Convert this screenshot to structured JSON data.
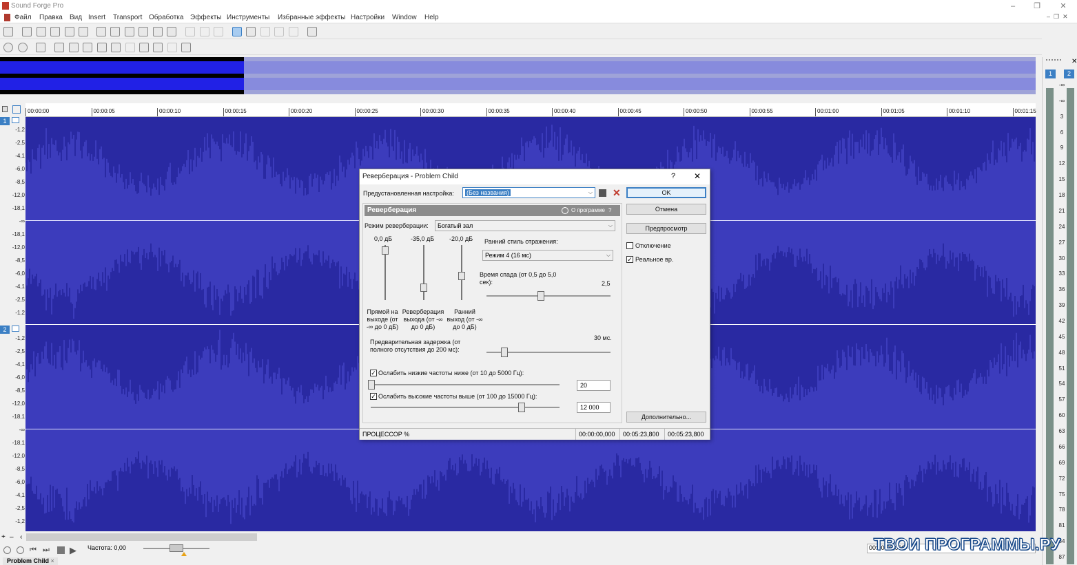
{
  "window": {
    "title": "Sound Forge Pro",
    "controls": [
      "minimize-icon",
      "restore-icon",
      "close-icon"
    ]
  },
  "menu": [
    "Файл",
    "Правка",
    "Вид",
    "Insert",
    "Transport",
    "Обработка",
    "Эффекты",
    "Инструменты",
    "Избранные эффекты",
    "Настройки",
    "Window",
    "Help"
  ],
  "ruler": {
    "ticks": [
      "00:00:00",
      "00:00:05",
      "00:00:10",
      "00:00:15",
      "00:00:20",
      "00:00:25",
      "00:00:30",
      "00:00:35",
      "00:00:40",
      "00:00:45",
      "00:00:50",
      "00:00:55",
      "00:01:00",
      "00:01:05",
      "00:01:10",
      "00:01:15"
    ]
  },
  "channels": [
    {
      "badge": "1",
      "db_labels": [
        "-1,2",
        "-2,5",
        "-4,1",
        "-6,0",
        "-8,5",
        "-12,0",
        "-18,1",
        "-∞",
        "-18,1",
        "-12,0",
        "-8,5",
        "-6,0",
        "-4,1",
        "-2,5",
        "-1,2"
      ]
    },
    {
      "badge": "2",
      "db_labels": [
        "-1,2",
        "-2,5",
        "-4,1",
        "-6,0",
        "-8,5",
        "-12,0",
        "-18,1",
        "-∞",
        "-18,1",
        "-12,0",
        "-8,5",
        "-6,0",
        "-4,1",
        "-2,5",
        "-1,2"
      ]
    }
  ],
  "vu": {
    "buttons": [
      "1",
      "2"
    ],
    "labels": [
      "-∞",
      "-∞",
      "3",
      "6",
      "9",
      "12",
      "15",
      "18",
      "21",
      "24",
      "27",
      "30",
      "33",
      "36",
      "39",
      "42",
      "45",
      "48",
      "51",
      "54",
      "57",
      "60",
      "63",
      "66",
      "69",
      "72",
      "75",
      "78",
      "81",
      "84",
      "87"
    ]
  },
  "bottom": {
    "rate_label": "Частота: 0,00",
    "tab_label": "Problem Child",
    "tab_close": "×",
    "status_time": "00:00:00,000"
  },
  "watermark": "ТВОИ ПРОГРАММЫ.РУ",
  "dialog": {
    "title": "Реверберация - Problem Child",
    "help": "?",
    "close": "✕",
    "preset_label": "Предустановленная настройка:",
    "preset_value": "(Без названия)",
    "ok": "OK",
    "cancel": "Отмена",
    "preview": "Предпросмотр",
    "bypass": "Отключение",
    "realtime": "Реальное вр.",
    "more": "Дополнительно...",
    "panel_title": "Реверберация",
    "about": "О программе",
    "about_help": "?",
    "mode_label": "Режим реверберации:",
    "mode_value": "Богатый зал",
    "slider_values": [
      "0,0 дБ",
      "-35,0 дБ",
      "-20,0 дБ"
    ],
    "slider_labels": [
      "Прямой на выходе (от -∞ до 0 дБ)",
      "Реверберация выхода (от -∞ до 0 дБ)",
      "Ранний выход (от -∞ до 0 дБ)"
    ],
    "slider_levels": [
      0.97,
      0.2,
      0.45
    ],
    "early_label": "Ранний стиль отражения:",
    "early_value": "Режим 4 (16 мс)",
    "decay_label": "Время спада (от 0,5 до 5,0 сек):",
    "decay_value": "2,5",
    "predelay_label": "Предварительная задержка (от полного отсутствия до 200 мс):",
    "predelay_value": "30 мс.",
    "lowcut_label": "Ослабить низкие частоты ниже (от 10 до 5000 Гц):",
    "lowcut_value": "20",
    "highcut_label": "Ослабить высокие частоты выше (от 100 до 15000 Гц):",
    "highcut_value": "12 000",
    "cpu_label": "ПРОЦЕССОР %",
    "times": [
      "00:00:00,000",
      "00:05:23,800",
      "00:05:23,800"
    ]
  }
}
